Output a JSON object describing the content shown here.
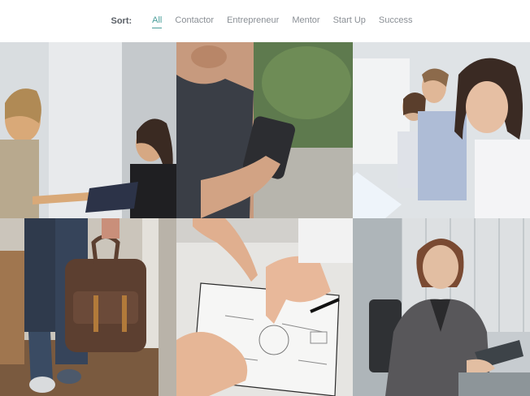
{
  "filter": {
    "label": "Sort:",
    "items": [
      "All",
      "Contactor",
      "Entrepreneur",
      "Mentor",
      "Start Up",
      "Success"
    ],
    "active": "All",
    "accent_color": "#4a9e9a"
  },
  "gallery": {
    "tiles": [
      {
        "id": "tile-1",
        "subject": "two-women-meeting"
      },
      {
        "id": "tile-2",
        "subject": "woman-holding-smartphone"
      },
      {
        "id": "tile-3",
        "subject": "office-team-smiling-woman"
      },
      {
        "id": "tile-4",
        "subject": "person-with-leather-backpack"
      },
      {
        "id": "tile-5",
        "subject": "hands-sketching-on-paper"
      },
      {
        "id": "tile-6",
        "subject": "businesswoman-in-office"
      }
    ]
  }
}
